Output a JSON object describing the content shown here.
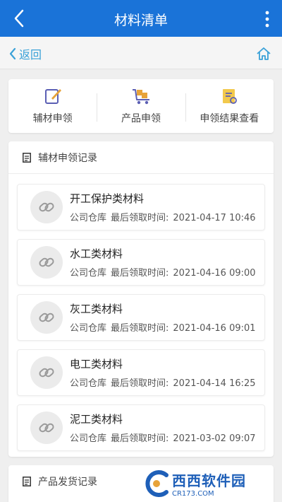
{
  "header": {
    "title": "材料清单",
    "back_icon": "chevron-left-icon",
    "menu_icon": "more-vertical-icon"
  },
  "subheader": {
    "back_label": "返回",
    "home_icon": "home-icon"
  },
  "actions": [
    {
      "label": "辅材申领",
      "icon": "edit-note-icon"
    },
    {
      "label": "产品申领",
      "icon": "trolley-icon"
    },
    {
      "label": "申领结果查看",
      "icon": "result-note-icon"
    }
  ],
  "records_panel": {
    "title": "辅材申领记录",
    "items": [
      {
        "name": "开工保护类材料",
        "warehouse": "公司仓库",
        "time_label": "最后领取时间:",
        "time": "2021-04-17 10:46"
      },
      {
        "name": "水工类材料",
        "warehouse": "公司仓库",
        "time_label": "最后领取时间:",
        "time": "2021-04-16 09:00"
      },
      {
        "name": "灰工类材料",
        "warehouse": "公司仓库",
        "time_label": "最后领取时间:",
        "time": "2021-04-16 09:01"
      },
      {
        "name": "电工类材料",
        "warehouse": "公司仓库",
        "time_label": "最后领取时间:",
        "time": "2021-04-14 16:25"
      },
      {
        "name": "泥工类材料",
        "warehouse": "公司仓库",
        "time_label": "最后领取时间:",
        "time": "2021-03-02 09:07"
      }
    ]
  },
  "delivery_panel": {
    "title": "产品发货记录"
  },
  "watermark": {
    "text": "西西软件园",
    "sub": "CR173.COM"
  },
  "colors": {
    "primary": "#1a73d8",
    "link": "#3aa1d8",
    "accent_orange": "#e7a33a"
  }
}
